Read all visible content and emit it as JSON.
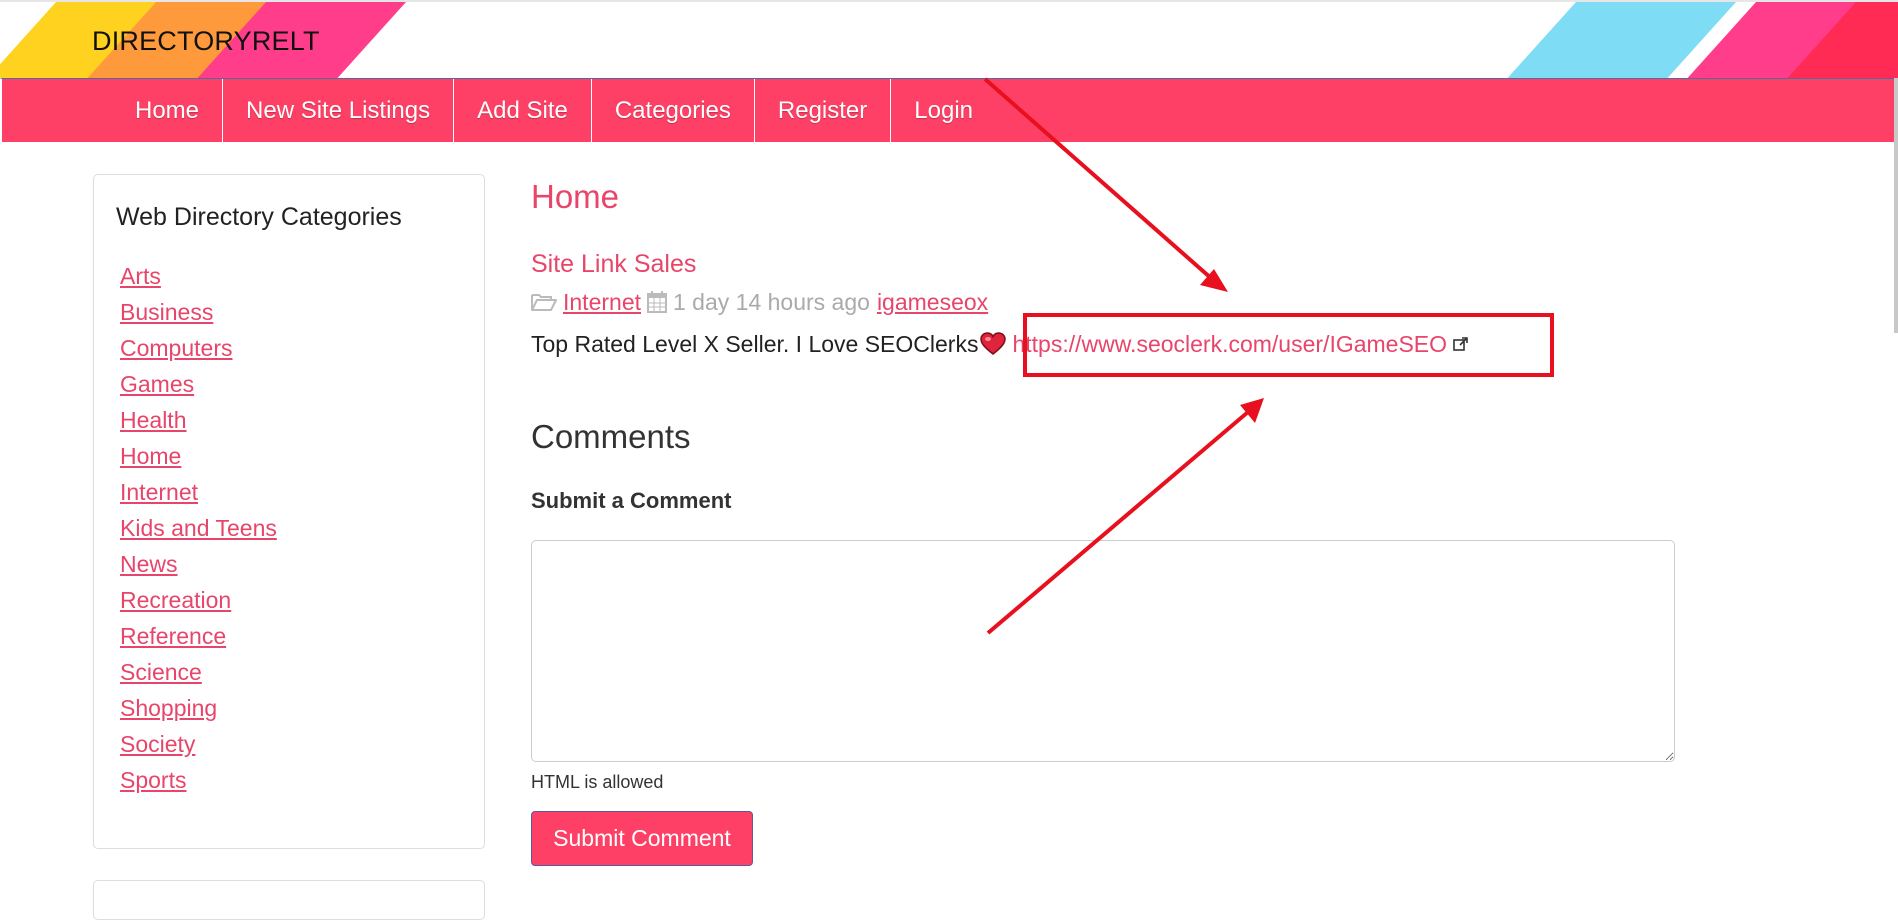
{
  "header": {
    "site_title": "DIRECTORYRELT"
  },
  "nav": {
    "items": [
      {
        "label": "Home"
      },
      {
        "label": "New Site Listings"
      },
      {
        "label": "Add Site"
      },
      {
        "label": "Categories"
      },
      {
        "label": "Register"
      },
      {
        "label": "Login"
      }
    ]
  },
  "sidebar": {
    "title": "Web Directory Categories",
    "categories": [
      "Arts",
      "Business",
      "Computers",
      "Games",
      "Health",
      "Home",
      "Internet",
      "Kids and Teens",
      "News",
      "Recreation",
      "Reference",
      "Science",
      "Shopping",
      "Society",
      "Sports"
    ]
  },
  "main": {
    "page_title": "Home",
    "listing": {
      "title": "Site Link Sales",
      "category": "Internet",
      "time_ago": "1 day 14 hours ago",
      "author": "igameseox",
      "description": "Top Rated Level X Seller. I Love SEOClerks",
      "url": "https://www.seoclerk.com/user/IGameSEO"
    },
    "comments_heading": "Comments",
    "submit_heading": "Submit a Comment",
    "comment_value": "",
    "help_text": "HTML is allowed",
    "submit_label": "Submit Comment"
  },
  "colors": {
    "brand": "#ff4066",
    "link": "#e8456a",
    "annotation": "#e8101e"
  },
  "icons": {
    "category": "folder-open-icon",
    "date": "calendar-icon",
    "heart": "heart-emoji-icon",
    "external": "external-link-icon"
  }
}
